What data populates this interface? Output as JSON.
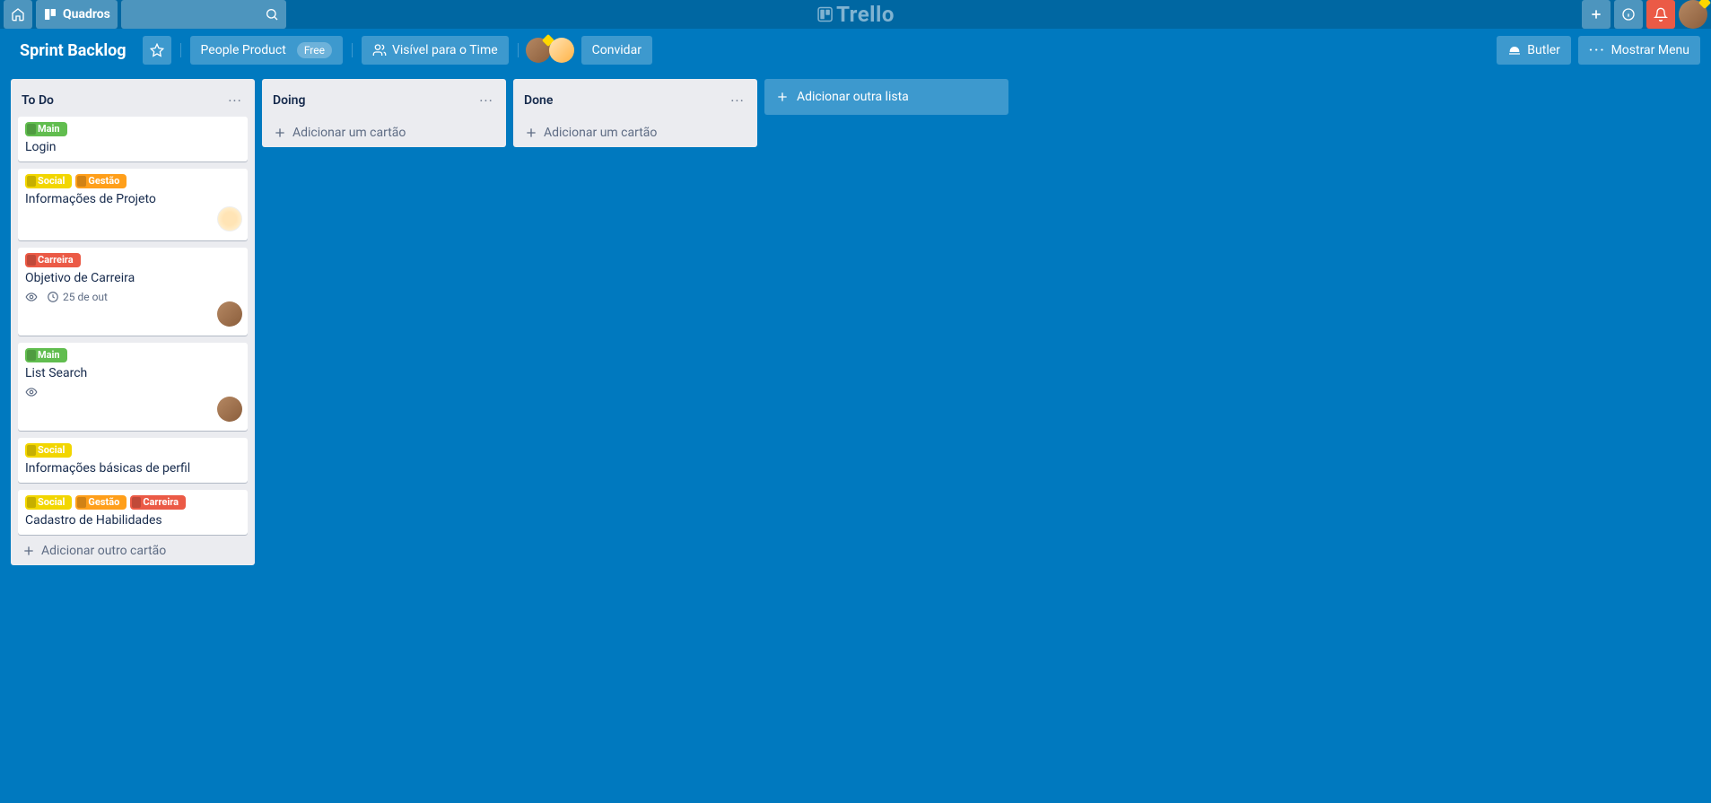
{
  "nav": {
    "boards_label": "Quadros",
    "logo": "Trello"
  },
  "board_header": {
    "title": "Sprint Backlog",
    "team_name": "People Product",
    "team_badge": "Free",
    "visibility": "Visível para o Time",
    "invite": "Convidar",
    "butler": "Butler",
    "show_menu": "Mostrar Menu"
  },
  "labels": {
    "main": "Main",
    "social": "Social",
    "gestao": "Gestão",
    "carreira": "Carreira"
  },
  "lists": {
    "todo": {
      "name": "To Do",
      "add_card": "Adicionar outro cartão",
      "cards": {
        "login": {
          "title": "Login"
        },
        "info_projeto": {
          "title": "Informações de Projeto"
        },
        "objetivo_carreira": {
          "title": "Objetivo de Carreira",
          "due": "25 de out"
        },
        "list_search": {
          "title": "List Search"
        },
        "info_perfil": {
          "title": "Informações básicas de perfil"
        },
        "cadastro_hab": {
          "title": "Cadastro de Habilidades"
        }
      }
    },
    "doing": {
      "name": "Doing",
      "add_card": "Adicionar um cartão"
    },
    "done": {
      "name": "Done",
      "add_card": "Adicionar um cartão"
    },
    "add_another_list": "Adicionar outra lista"
  }
}
